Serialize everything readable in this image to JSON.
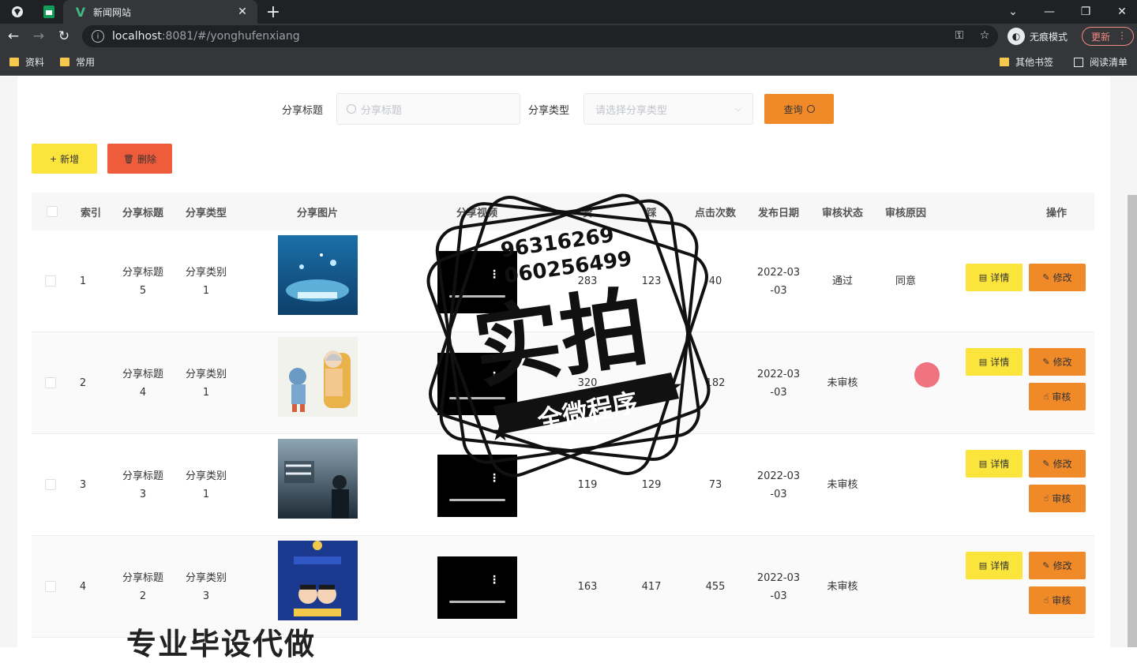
{
  "browser": {
    "tab_title": "新闻网站",
    "url_host": "localhost",
    "url_rest": ":8081/#/yonghufenxiang",
    "profile_label": "无痕模式",
    "update_label": "更新",
    "bookmarks": [
      "资料",
      "常用"
    ],
    "bookmarks_right": [
      "其他书签",
      "阅读清单"
    ]
  },
  "search": {
    "title_label": "分享标题",
    "title_placeholder": "分享标题",
    "type_label": "分享类型",
    "type_placeholder": "请选择分享类型",
    "query_button": "查询"
  },
  "actions": {
    "add_button": "新增",
    "delete_button": "删除"
  },
  "table": {
    "headers": [
      "索引",
      "分享标题",
      "分享类型",
      "分享图片",
      "分享视频",
      "赞",
      "踩",
      "点击次数",
      "发布日期",
      "审核状态",
      "审核原因",
      "操作"
    ],
    "rows": [
      {
        "index": "1",
        "title_a": "分享标题",
        "title_b": "5",
        "type_a": "分享类别",
        "type_b": "1",
        "likes": "283",
        "dislikes": "123",
        "clicks": "40",
        "date_a": "2022-03",
        "date_b": "-03",
        "status": "通过",
        "reason": "同意"
      },
      {
        "index": "2",
        "title_a": "分享标题",
        "title_b": "4",
        "type_a": "分享类别",
        "type_b": "1",
        "likes": "320",
        "dislikes": "",
        "clicks": "182",
        "date_a": "2022-03",
        "date_b": "-03",
        "status": "未审核",
        "reason": ""
      },
      {
        "index": "3",
        "title_a": "分享标题",
        "title_b": "3",
        "type_a": "分享类别",
        "type_b": "1",
        "likes": "119",
        "dislikes": "129",
        "clicks": "73",
        "date_a": "2022-03",
        "date_b": "-03",
        "status": "未审核",
        "reason": ""
      },
      {
        "index": "4",
        "title_a": "分享标题",
        "title_b": "2",
        "type_a": "分享类别",
        "type_b": "3",
        "likes": "163",
        "dislikes": "417",
        "clicks": "455",
        "date_a": "2022-03",
        "date_b": "-03",
        "status": "未审核",
        "reason": ""
      }
    ],
    "btn_detail": "详情",
    "btn_edit": "修改",
    "btn_review": "审核"
  },
  "watermark": {
    "phone1": "96316269",
    "phone2": "060256499",
    "big": "实拍",
    "banner": "全微程序",
    "bottom": "专业毕设代做"
  },
  "colors": {
    "orange": "#f08a29",
    "yellow": "#fbe43b",
    "red": "#ef5c3b"
  }
}
